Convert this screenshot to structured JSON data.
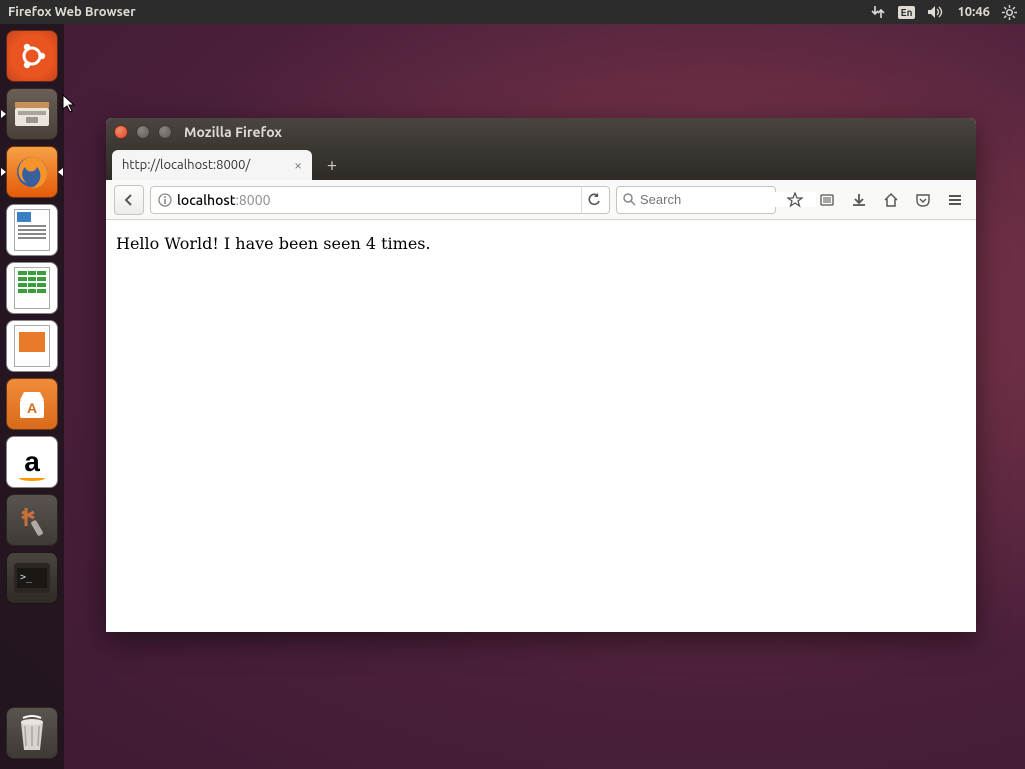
{
  "top_bar": {
    "app_title": "Firefox Web Browser",
    "language": "En",
    "time": "10:46"
  },
  "launcher": {
    "items": [
      {
        "name": "ubuntu-dash",
        "label": "Dash"
      },
      {
        "name": "files",
        "label": "Files"
      },
      {
        "name": "firefox",
        "label": "Firefox"
      },
      {
        "name": "writer",
        "label": "LibreOffice Writer"
      },
      {
        "name": "calc",
        "label": "LibreOffice Calc"
      },
      {
        "name": "impress",
        "label": "LibreOffice Impress"
      },
      {
        "name": "software",
        "label": "Ubuntu Software"
      },
      {
        "name": "amazon",
        "label": "Amazon"
      },
      {
        "name": "settings",
        "label": "System Settings"
      },
      {
        "name": "terminal",
        "label": "Terminal"
      }
    ],
    "trash": "Trash"
  },
  "window": {
    "title": "Mozilla Firefox",
    "tab": {
      "label": "http://localhost:8000/"
    },
    "url": {
      "host": "localhost",
      "port": ":8000",
      "full": "localhost:8000"
    },
    "search_placeholder": "Search",
    "page_content": "Hello World! I have been seen 4 times."
  }
}
